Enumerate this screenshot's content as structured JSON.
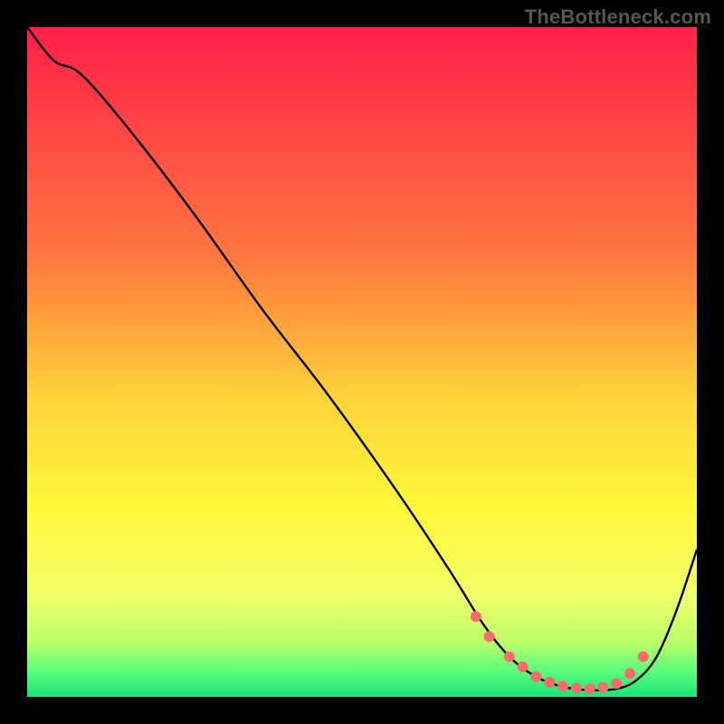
{
  "watermark": "TheBottleneck.com",
  "chart_data": {
    "type": "line",
    "title": "",
    "xlabel": "",
    "ylabel": "",
    "xlim": [
      0,
      100
    ],
    "ylim": [
      0,
      100
    ],
    "gradient_stops": [
      {
        "offset": 0,
        "color": "#ff1f49"
      },
      {
        "offset": 35,
        "color": "#ff7a3e"
      },
      {
        "offset": 55,
        "color": "#ffd23a"
      },
      {
        "offset": 72,
        "color": "#fff93a"
      },
      {
        "offset": 85,
        "color": "#f1ff6a"
      },
      {
        "offset": 92,
        "color": "#b9ff6a"
      },
      {
        "offset": 96,
        "color": "#5dff7a"
      },
      {
        "offset": 100,
        "color": "#19e37a"
      }
    ],
    "series": [
      {
        "name": "bottleneck-curve",
        "color": "#000000",
        "x": [
          0,
          4,
          8,
          15,
          25,
          35,
          45,
          55,
          63,
          68,
          72,
          76,
          80,
          84,
          88,
          91,
          94,
          97,
          100
        ],
        "y": [
          100,
          95,
          93,
          85,
          72,
          58,
          45,
          31,
          19,
          11,
          6,
          3,
          1.5,
          1,
          1.2,
          2.5,
          6,
          13,
          22
        ]
      }
    ],
    "markers": {
      "name": "highlight-points",
      "color": "#ff6b6b",
      "radius": 6,
      "x": [
        67,
        69,
        72,
        74,
        76,
        78,
        80,
        82,
        84,
        86,
        88,
        90,
        92
      ],
      "y": [
        12,
        9,
        6,
        4.5,
        3,
        2.2,
        1.6,
        1.3,
        1.2,
        1.4,
        2,
        3.5,
        6
      ]
    }
  }
}
